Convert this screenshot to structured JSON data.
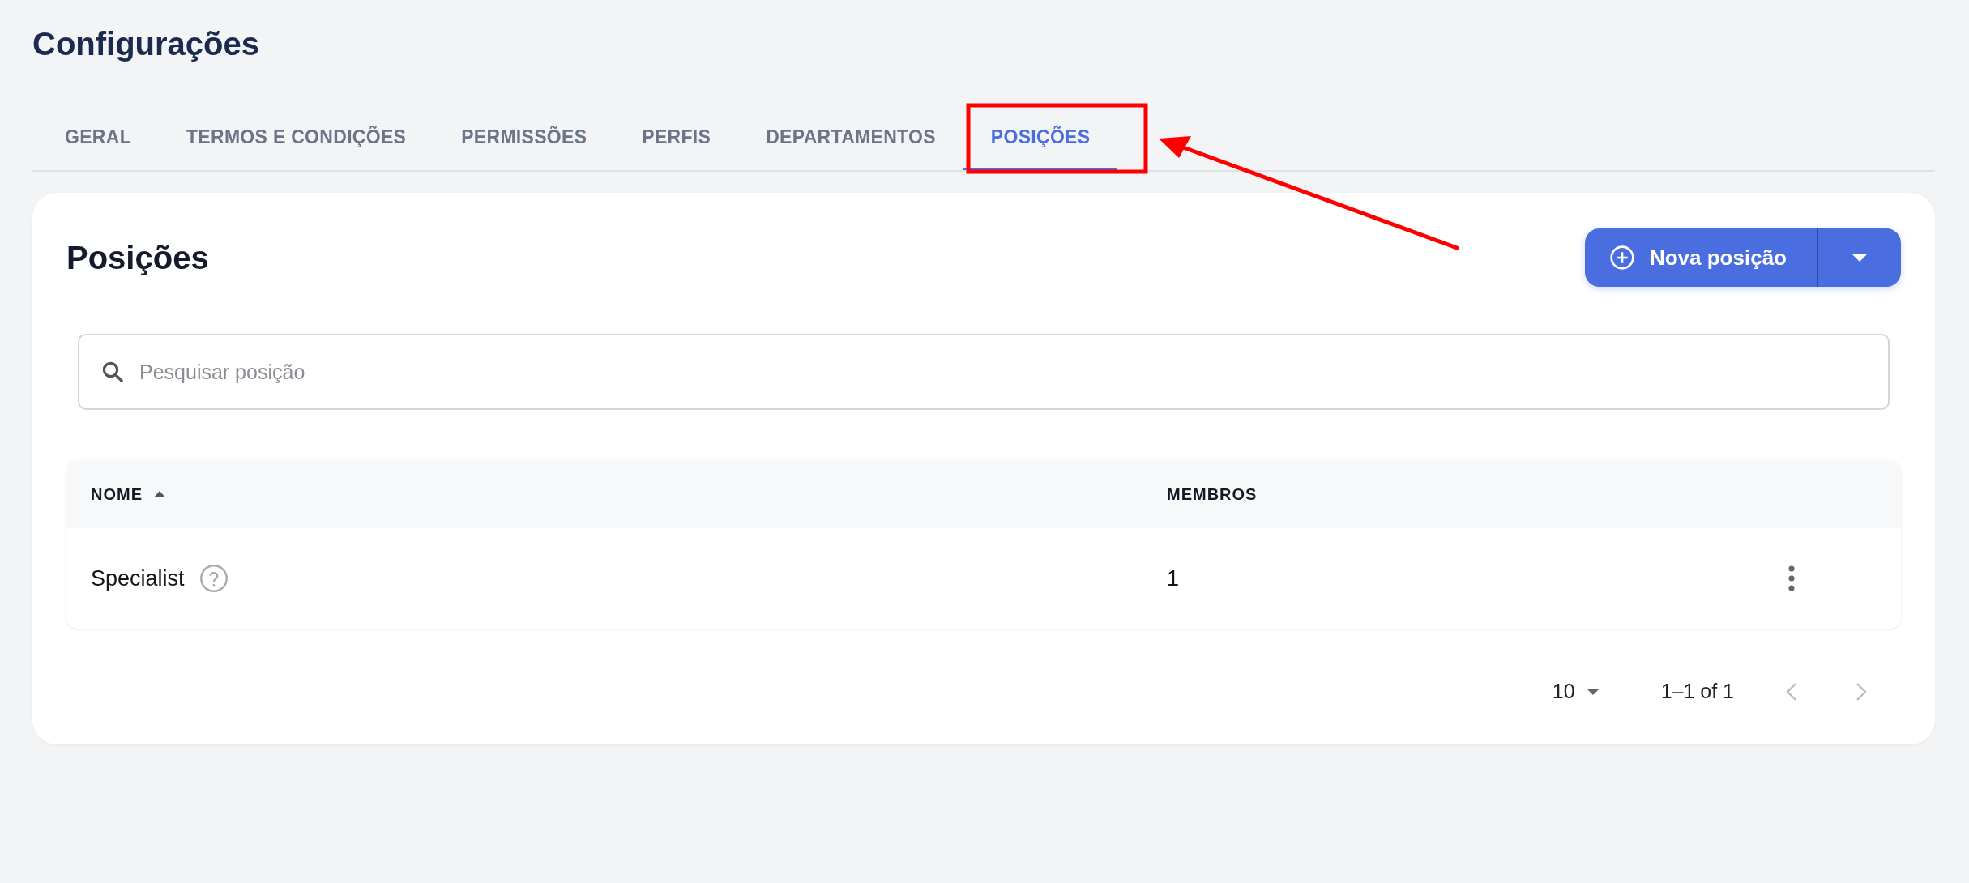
{
  "page": {
    "title": "Configurações"
  },
  "tabs": [
    {
      "label": "GERAL",
      "selected": false
    },
    {
      "label": "TERMOS E CONDIÇÕES",
      "selected": false
    },
    {
      "label": "PERMISSÕES",
      "selected": false
    },
    {
      "label": "PERFIS",
      "selected": false
    },
    {
      "label": "DEPARTAMENTOS",
      "selected": false
    },
    {
      "label": "POSIÇÕES",
      "selected": true
    }
  ],
  "card": {
    "title": "Posições",
    "primary_button": "Nova posição"
  },
  "search": {
    "placeholder": "Pesquisar posição"
  },
  "table": {
    "columns": [
      {
        "label": "NOME",
        "sorted": true
      },
      {
        "label": "MEMBROS",
        "sorted": false
      }
    ],
    "rows": [
      {
        "name": "Specialist",
        "members": "1"
      }
    ]
  },
  "pagination": {
    "page_size": "10",
    "range": "1–1 of 1"
  }
}
